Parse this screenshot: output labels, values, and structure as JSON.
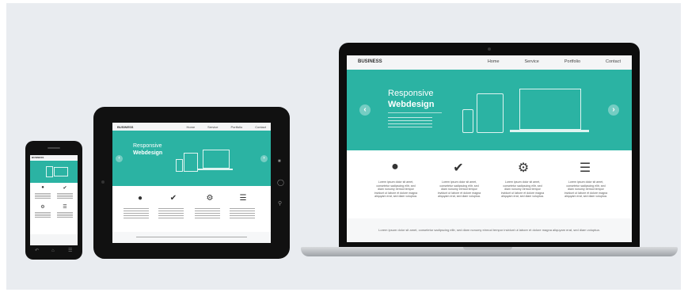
{
  "site": {
    "brand": "BUSINESS",
    "nav": [
      "Home",
      "Service",
      "Portfolio",
      "Contact"
    ],
    "hero_title_line1": "Responsive",
    "hero_title_line2": "Webdesign",
    "features": [
      {
        "icon": "user-icon",
        "text": "Lorem ipsum dolor sit amet, consetetur sadipscing elitr, sed diam nonumy eirmod tempor invidunt ut labore et dolore magna aliquyam erat, sed diam voluptua."
      },
      {
        "icon": "check-icon",
        "text": "Lorem ipsum dolor sit amet, consetetur sadipscing elitr, sed diam nonumy eirmod tempor invidunt ut labore et dolore magna aliquyam erat, sed diam voluptua."
      },
      {
        "icon": "gear-icon",
        "text": "Lorem ipsum dolor sit amet, consetetur sadipscing elitr, sed diam nonumy eirmod tempor invidunt ut labore et dolore magna aliquyam erat, sed diam voluptua."
      },
      {
        "icon": "list-icon",
        "text": "Lorem ipsum dolor sit amet, consetetur sadipscing elitr, sed diam nonumy eirmod tempor invidunt ut labore et dolore magna aliquyam erat, sed diam voluptua."
      }
    ],
    "footer": "Lorem ipsum dolor sit amet, consetetur sadipscing elitr, sed diam nonumy eirmod tempor invidunt ut labore et dolore magna aliquyam erat, sed diam voluptua."
  },
  "colors": {
    "accent": "#2bb3a3",
    "device": "#111111",
    "backdrop": "#e9ecf0"
  }
}
